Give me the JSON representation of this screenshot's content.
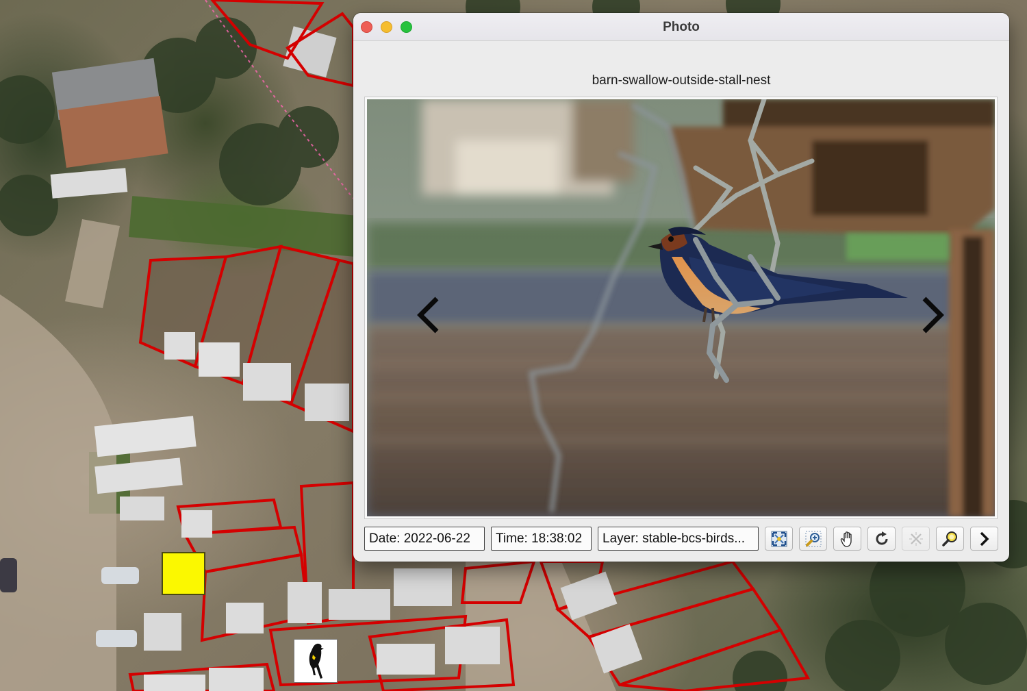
{
  "window": {
    "title": "Photo",
    "photo_name": "barn-swallow-outside-stall-nest"
  },
  "status": {
    "date": "Date: 2022-06-22",
    "time": "Time: 18:38:02",
    "layer": "Layer: stable-bcs-birds..."
  },
  "toolbar": {
    "buttons": [
      {
        "name": "fit-to-window",
        "icon": "fit-icon",
        "enabled": true
      },
      {
        "name": "zoom",
        "icon": "zoom-in-icon",
        "enabled": true
      },
      {
        "name": "pan",
        "icon": "hand-icon",
        "enabled": true
      },
      {
        "name": "rotate",
        "icon": "rotate-icon",
        "enabled": true
      },
      {
        "name": "clear",
        "icon": "clear-icon",
        "enabled": false
      },
      {
        "name": "locate",
        "icon": "locate-icon",
        "enabled": true
      },
      {
        "name": "next",
        "icon": "chevron-right-icon",
        "enabled": true
      }
    ]
  },
  "map": {
    "marker_selected_color": "#fbf800",
    "parcel_outline_color": "#d40000",
    "bird_marker_icon": "blackbird-icon"
  },
  "colors": {
    "close": "#ee5e56",
    "minimize": "#f5bd2f",
    "maximize": "#27c23e"
  }
}
